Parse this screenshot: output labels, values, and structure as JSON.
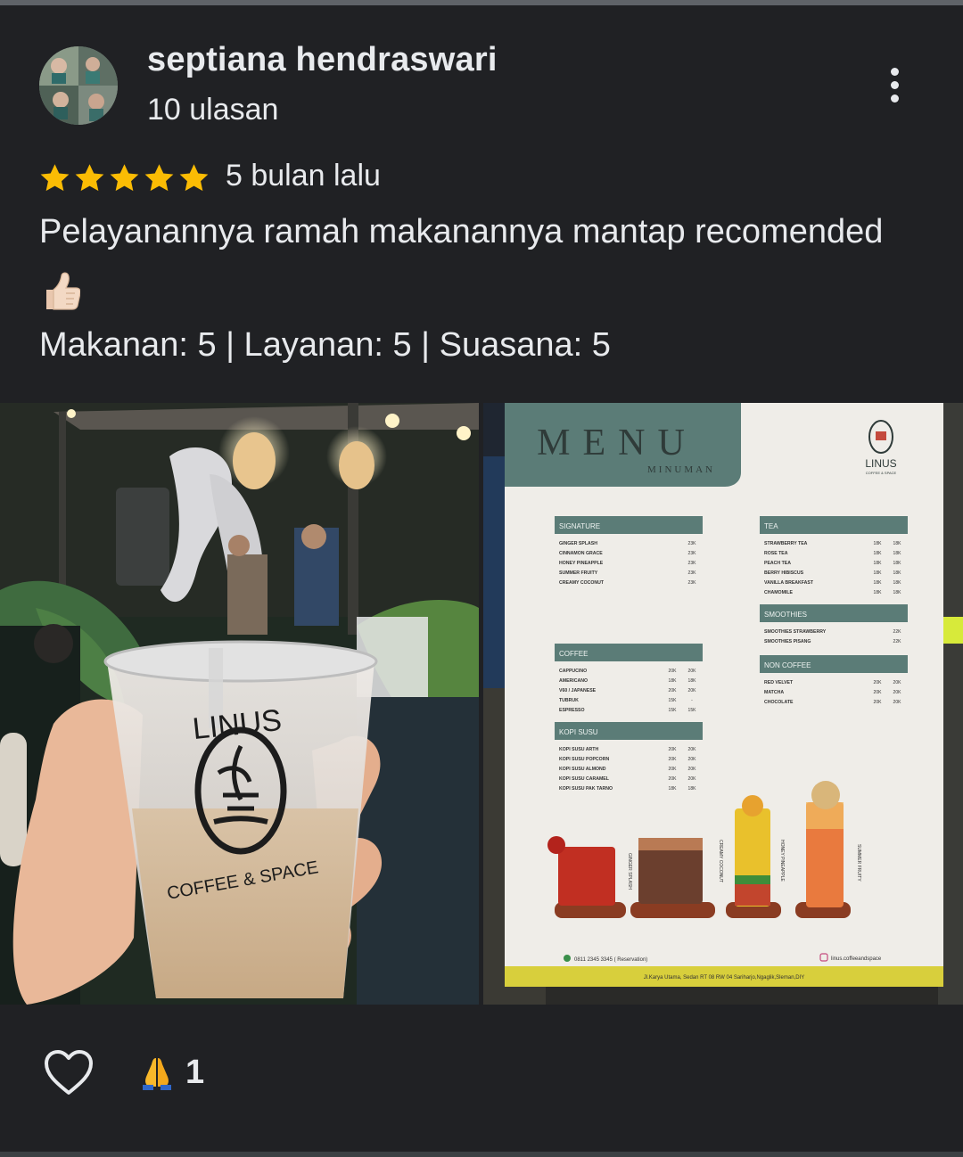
{
  "reviewer": {
    "name": "septiana hendraswari",
    "review_count": "10 ulasan"
  },
  "review": {
    "rating": 5,
    "time": "5 bulan lalu",
    "text": "Pelayanannya ramah makanannya mantap recomended",
    "emoji": "thumbs-up-emoji",
    "ratings_line": "Makanan: 5 | Layanan: 5 | Suasana: 5"
  },
  "photo_left": {
    "cup_brand": "LINUS",
    "cup_tagline": "COFFEE & SPACE"
  },
  "photo_right": {
    "menu_title": "MENU",
    "menu_subtitle": "MINUMAN",
    "brand": "LINUS",
    "brand_tagline": "COFFEE & SPACE",
    "sections": {
      "signature": {
        "title": "SIGNATURE",
        "items": [
          {
            "name": "GINGER SPLASH",
            "price": "23K"
          },
          {
            "name": "CINNAMON GRACE",
            "price": "23K"
          },
          {
            "name": "HONEY PINEAPPLE",
            "price": "23K"
          },
          {
            "name": "SUMMER FRUITY",
            "price": "23K"
          },
          {
            "name": "CREAMY COCONUT",
            "price": "23K"
          }
        ]
      },
      "coffee": {
        "title": "COFFEE",
        "items": [
          {
            "name": "CAPPUCINO",
            "hot": "20K",
            "cold": "20K"
          },
          {
            "name": "AMERICANO",
            "hot": "18K",
            "cold": "18K"
          },
          {
            "name": "V60 / JAPANESE",
            "hot": "20K",
            "cold": "20K"
          },
          {
            "name": "TUBRUK",
            "hot": "15K",
            "cold": "-"
          },
          {
            "name": "ESPRESSO",
            "hot": "15K",
            "cold": "15K"
          }
        ]
      },
      "kopi_susu": {
        "title": "KOPI SUSU",
        "items": [
          {
            "name": "KOPI SUSU ARTH",
            "hot": "20K",
            "cold": "20K"
          },
          {
            "name": "KOPI SUSU POPCORN",
            "hot": "20K",
            "cold": "20K"
          },
          {
            "name": "KOPI SUSU ALMOND",
            "hot": "20K",
            "cold": "20K"
          },
          {
            "name": "KOPI SUSU CARAMEL",
            "hot": "20K",
            "cold": "20K"
          },
          {
            "name": "KOPI SUSU PAK TARNO",
            "hot": "18K",
            "cold": "18K"
          }
        ]
      },
      "tea": {
        "title": "TEA",
        "items": [
          {
            "name": "STRAWBERRY TEA",
            "hot": "18K",
            "cold": "18K"
          },
          {
            "name": "ROSE TEA",
            "hot": "18K",
            "cold": "18K"
          },
          {
            "name": "PEACH TEA",
            "hot": "18K",
            "cold": "18K"
          },
          {
            "name": "BERRY HIBISCUS",
            "hot": "18K",
            "cold": "18K"
          },
          {
            "name": "VANILLA BREAKFAST",
            "hot": "18K",
            "cold": "18K"
          },
          {
            "name": "CHAMOMILE",
            "hot": "18K",
            "cold": "18K"
          }
        ]
      },
      "smoothies": {
        "title": "SMOOTHIES",
        "items": [
          {
            "name": "SMOOTHIES STRAWBERRY",
            "price": "22K"
          },
          {
            "name": "SMOOTHIES PISANG",
            "price": "22K"
          }
        ]
      },
      "non_coffee": {
        "title": "NON COFFEE",
        "items": [
          {
            "name": "RED VELVET",
            "hot": "20K",
            "cold": "20K"
          },
          {
            "name": "MATCHA",
            "hot": "20K",
            "cold": "20K"
          },
          {
            "name": "CHOCOLATE",
            "hot": "20K",
            "cold": "20K"
          }
        ]
      }
    },
    "drink_labels": [
      "GINGER SPLASH",
      "CREAMY COCONUT",
      "HONEY PINEAPPLE",
      "SUMMER FRUITY"
    ],
    "phone": "0811 2345 3345 ( Reservation)",
    "instagram": "linus.coffeeandspace",
    "address": "Jl.Karya Utama, Sedan RT 08 RW 04 Sariharjo,Ngaglik,Sleman,DIY"
  },
  "actions": {
    "like_icon": "heart-outline-icon",
    "reaction_icon": "folded-hands-emoji",
    "reaction_count": "1"
  },
  "colors": {
    "background": "#202124",
    "text": "#e8eaed",
    "star": "#fbbc04",
    "menu_accent": "#5b7c77"
  }
}
